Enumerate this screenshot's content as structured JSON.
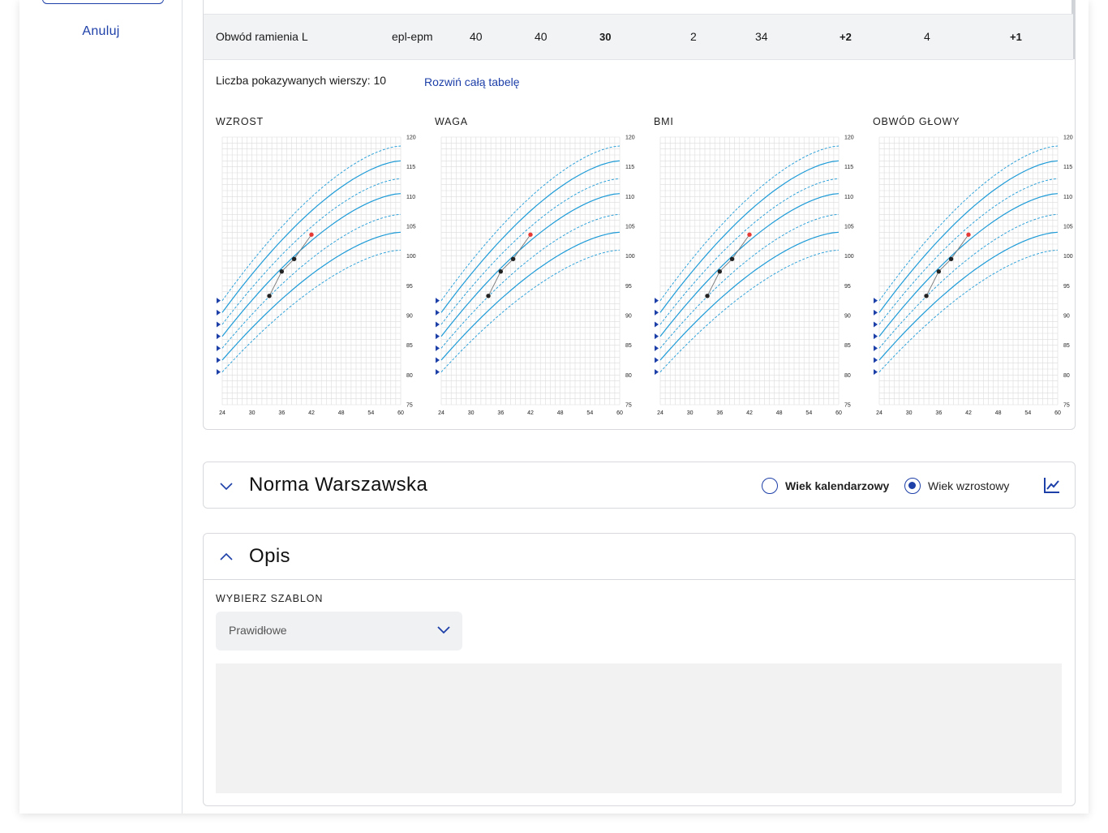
{
  "sidebar": {
    "cancel_label": "Anuluj"
  },
  "table_row": {
    "name": "Obwód ramienia L",
    "type": "epl-epm",
    "v1": "40",
    "v2": "40",
    "v3": "30",
    "v4": "2",
    "v5": "34",
    "v6": "+2",
    "v7": "4",
    "v8": "+1"
  },
  "table_footer": {
    "rows_info": "Liczba pokazywanych wierszy: 10",
    "expand_link": "Rozwiń całą tabelę"
  },
  "charts": {
    "titles": [
      "WZROST",
      "WAGA",
      "BMI",
      "OBWÓD GŁOWY"
    ],
    "x_ticks": [
      "24",
      "30",
      "36",
      "42",
      "48",
      "54",
      "60"
    ],
    "y_ticks": [
      "120",
      "115",
      "110",
      "105",
      "100",
      "95",
      "90",
      "85",
      "80",
      "75"
    ]
  },
  "chart_data": [
    {
      "type": "line",
      "title": "WZROST",
      "xlim": [
        24,
        60
      ],
      "ylim": [
        75,
        120
      ],
      "x_ticks": [
        24,
        30,
        36,
        42,
        48,
        54,
        60
      ],
      "y_ticks": [
        75,
        80,
        85,
        90,
        95,
        100,
        105,
        110,
        115,
        120
      ],
      "percentile_curves": [
        {
          "style": "dashed",
          "start": 92.5,
          "end": 118.5
        },
        {
          "style": "solid",
          "start": 90.5,
          "end": 116
        },
        {
          "style": "dashed",
          "start": 88.5,
          "end": 113
        },
        {
          "style": "solid",
          "start": 86.5,
          "end": 110.5
        },
        {
          "style": "dashed",
          "start": 84.5,
          "end": 107
        },
        {
          "style": "solid",
          "start": 82.5,
          "end": 104
        },
        {
          "style": "dashed",
          "start": 80.5,
          "end": 101
        }
      ],
      "measurements": [
        {
          "x": 33.5,
          "y": 93.3,
          "color": "#222"
        },
        {
          "x": 36,
          "y": 97.4,
          "color": "#222"
        },
        {
          "x": 38.5,
          "y": 99.5,
          "color": "#222"
        },
        {
          "x": 42,
          "y": 103.6,
          "color": "#e53935"
        }
      ]
    },
    {
      "type": "line",
      "title": "WAGA",
      "xlim": [
        24,
        60
      ],
      "ylim": [
        75,
        120
      ],
      "x_ticks": [
        24,
        30,
        36,
        42,
        48,
        54,
        60
      ],
      "y_ticks": [
        75,
        80,
        85,
        90,
        95,
        100,
        105,
        110,
        115,
        120
      ],
      "percentile_curves": [
        {
          "style": "dashed",
          "start": 92.5,
          "end": 118.5
        },
        {
          "style": "solid",
          "start": 90.5,
          "end": 116
        },
        {
          "style": "dashed",
          "start": 88.5,
          "end": 113
        },
        {
          "style": "solid",
          "start": 86.5,
          "end": 110.5
        },
        {
          "style": "dashed",
          "start": 84.5,
          "end": 107
        },
        {
          "style": "solid",
          "start": 82.5,
          "end": 104
        },
        {
          "style": "dashed",
          "start": 80.5,
          "end": 101
        }
      ],
      "measurements": [
        {
          "x": 33.5,
          "y": 93.3,
          "color": "#222"
        },
        {
          "x": 36,
          "y": 97.4,
          "color": "#222"
        },
        {
          "x": 38.5,
          "y": 99.5,
          "color": "#222"
        },
        {
          "x": 42,
          "y": 103.6,
          "color": "#e53935"
        }
      ]
    },
    {
      "type": "line",
      "title": "BMI",
      "xlim": [
        24,
        60
      ],
      "ylim": [
        75,
        120
      ],
      "x_ticks": [
        24,
        30,
        36,
        42,
        48,
        54,
        60
      ],
      "y_ticks": [
        75,
        80,
        85,
        90,
        95,
        100,
        105,
        110,
        115,
        120
      ],
      "percentile_curves": [
        {
          "style": "dashed",
          "start": 92.5,
          "end": 118.5
        },
        {
          "style": "solid",
          "start": 90.5,
          "end": 116
        },
        {
          "style": "dashed",
          "start": 88.5,
          "end": 113
        },
        {
          "style": "solid",
          "start": 86.5,
          "end": 110.5
        },
        {
          "style": "dashed",
          "start": 84.5,
          "end": 107
        },
        {
          "style": "solid",
          "start": 82.5,
          "end": 104
        },
        {
          "style": "dashed",
          "start": 80.5,
          "end": 101
        }
      ],
      "measurements": [
        {
          "x": 33.5,
          "y": 93.3,
          "color": "#222"
        },
        {
          "x": 36,
          "y": 97.4,
          "color": "#222"
        },
        {
          "x": 38.5,
          "y": 99.5,
          "color": "#222"
        },
        {
          "x": 42,
          "y": 103.6,
          "color": "#e53935"
        }
      ]
    },
    {
      "type": "line",
      "title": "OBWÓD GŁOWY",
      "xlim": [
        24,
        60
      ],
      "ylim": [
        75,
        120
      ],
      "x_ticks": [
        24,
        30,
        36,
        42,
        48,
        54,
        60
      ],
      "y_ticks": [
        75,
        80,
        85,
        90,
        95,
        100,
        105,
        110,
        115,
        120
      ],
      "percentile_curves": [
        {
          "style": "dashed",
          "start": 92.5,
          "end": 118.5
        },
        {
          "style": "solid",
          "start": 90.5,
          "end": 116
        },
        {
          "style": "dashed",
          "start": 88.5,
          "end": 113
        },
        {
          "style": "solid",
          "start": 86.5,
          "end": 110.5
        },
        {
          "style": "dashed",
          "start": 84.5,
          "end": 107
        },
        {
          "style": "solid",
          "start": 82.5,
          "end": 104
        },
        {
          "style": "dashed",
          "start": 80.5,
          "end": 101
        }
      ],
      "measurements": [
        {
          "x": 33.5,
          "y": 93.3,
          "color": "#222"
        },
        {
          "x": 36,
          "y": 97.4,
          "color": "#222"
        },
        {
          "x": 38.5,
          "y": 99.5,
          "color": "#222"
        },
        {
          "x": 42,
          "y": 103.6,
          "color": "#e53935"
        }
      ]
    }
  ],
  "norma": {
    "title": "Norma Warszawska",
    "radio_calendar": "Wiek kalendarzowy",
    "radio_height": "Wiek wzrostowy",
    "selected": "Wiek wzrostowy",
    "chart_icon": "chart-line-icon"
  },
  "opis": {
    "title": "Opis",
    "template_label": "WYBIERZ SZABLON",
    "template_value": "Prawidłowe",
    "description_value": ""
  },
  "colors": {
    "accent": "#1d3fa8",
    "curve": "#1e9bd7",
    "grid": "#d9d9d9",
    "highlight_point": "#e53935"
  }
}
